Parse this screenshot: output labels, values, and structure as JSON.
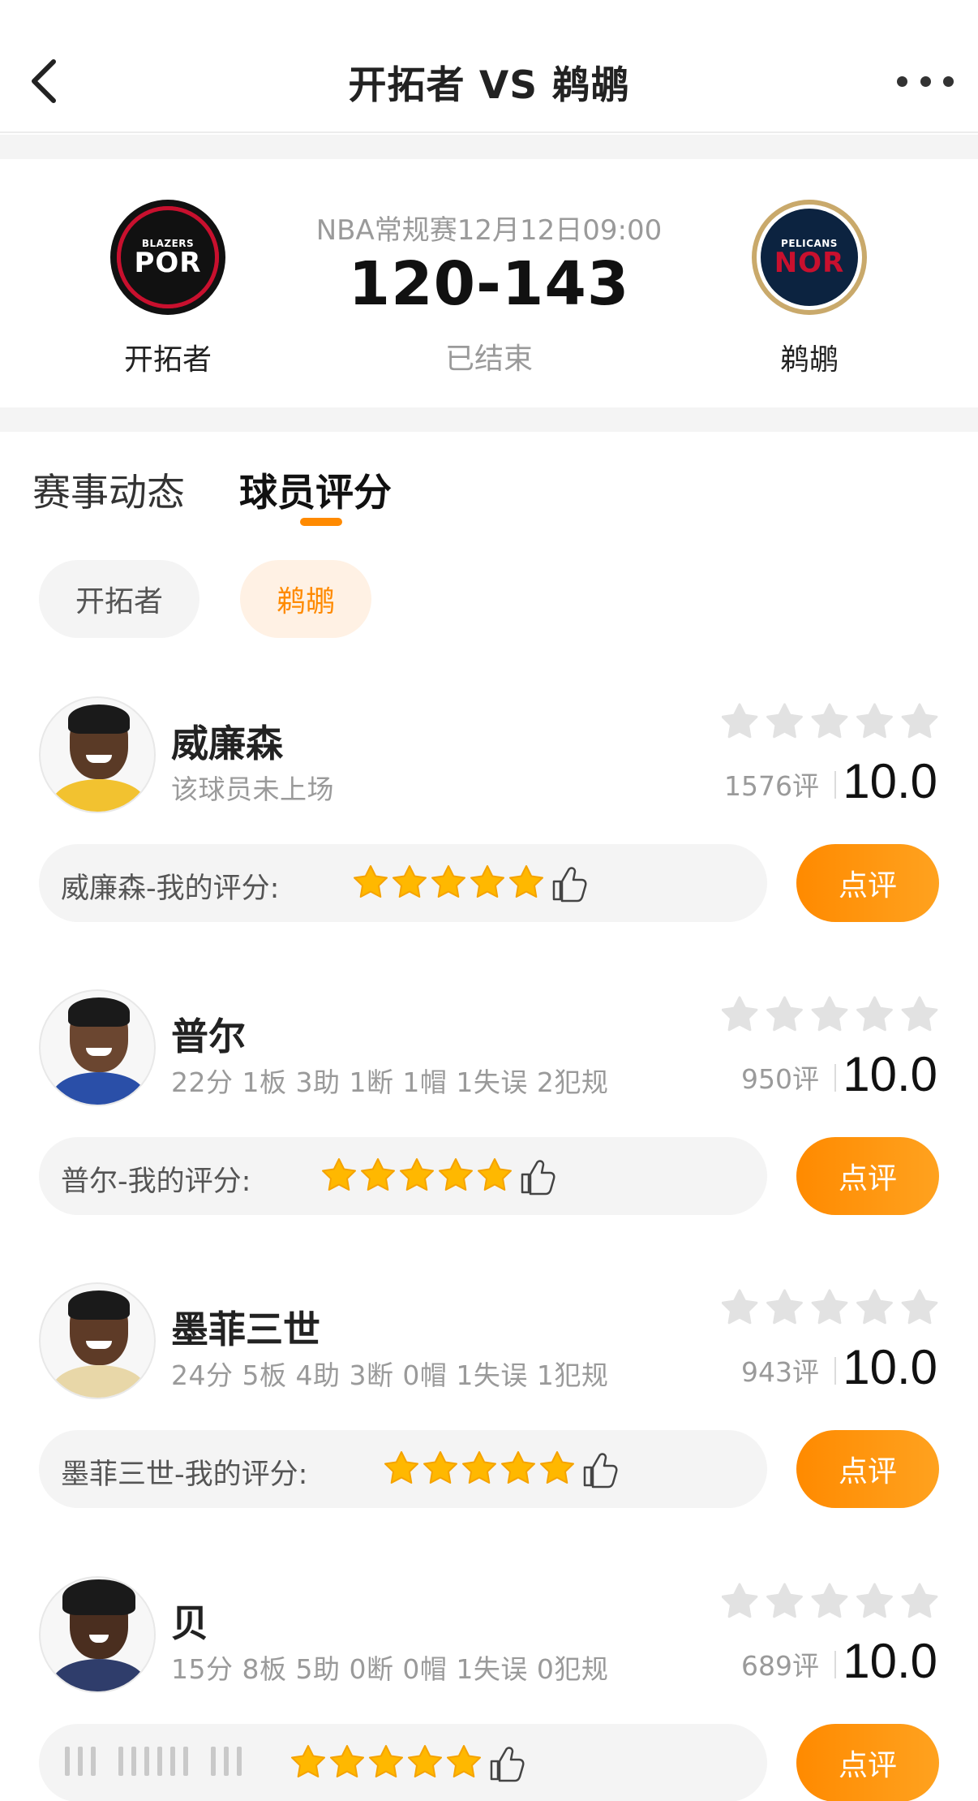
{
  "nav": {
    "title": "开拓者 VS 鹈鹕"
  },
  "match": {
    "meta": "NBA常规赛12月12日09:00",
    "score": "120-143",
    "status": "已结束",
    "home": {
      "name": "开拓者",
      "logo_small": "BLAZERS",
      "logo_big": "POR"
    },
    "away": {
      "name": "鹈鹕",
      "logo_small": "PELICANS",
      "logo_big": "NOR"
    }
  },
  "tabs": [
    {
      "label": "赛事动态"
    },
    {
      "label": "球员评分"
    }
  ],
  "team_filter": [
    {
      "label": "开拓者"
    },
    {
      "label": "鹈鹕"
    }
  ],
  "players": [
    {
      "name": "威廉森",
      "stats": "该球员未上场",
      "rating_count": "1576评",
      "rating_score": "10.0",
      "my_rating_label": "威廉森-我的评分:",
      "review_label": "点评"
    },
    {
      "name": "普尔",
      "stats": "22分 1板 3助 1断 1帽 1失误 2犯规",
      "rating_count": "950评",
      "rating_score": "10.0",
      "my_rating_label": "普尔-我的评分:",
      "review_label": "点评"
    },
    {
      "name": "墨菲三世",
      "stats": "24分 5板 4助 3断 0帽 1失误 1犯规",
      "rating_count": "943评",
      "rating_score": "10.0",
      "my_rating_label": "墨菲三世-我的评分:",
      "review_label": "点评"
    },
    {
      "name": "贝",
      "stats": "15分 8板 5助 0断 0帽 1失误 0犯规",
      "rating_count": "689评",
      "rating_score": "10.0",
      "my_rating_label": "",
      "review_label": "点评"
    }
  ],
  "icons": {
    "back": "chevron-left-icon",
    "more": "more-dots-icon",
    "star": "star-icon",
    "like": "thumbs-up-icon"
  },
  "colors": {
    "accent": "#ff8a00",
    "star_filled": "#ffb800",
    "star_empty": "#e2e2e2"
  }
}
